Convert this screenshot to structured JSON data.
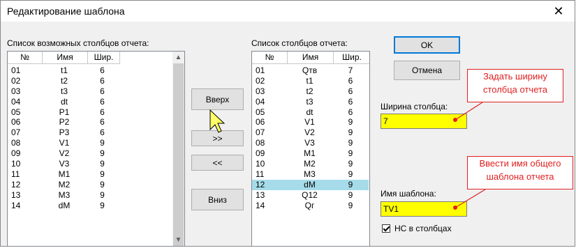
{
  "window": {
    "title": "Редактирование шаблона",
    "close_label": "✕"
  },
  "available": {
    "label": "Список возможных столбцов отчета:",
    "headers": [
      "№",
      "Имя",
      "Шир."
    ],
    "rows": [
      [
        "01",
        "t1",
        "6"
      ],
      [
        "02",
        "t2",
        "6"
      ],
      [
        "03",
        "t3",
        "6"
      ],
      [
        "04",
        "dt",
        "6"
      ],
      [
        "05",
        "P1",
        "6"
      ],
      [
        "06",
        "P2",
        "6"
      ],
      [
        "07",
        "P3",
        "6"
      ],
      [
        "08",
        "V1",
        "9"
      ],
      [
        "09",
        "V2",
        "9"
      ],
      [
        "10",
        "V3",
        "9"
      ],
      [
        "11",
        "M1",
        "9"
      ],
      [
        "12",
        "M2",
        "9"
      ],
      [
        "13",
        "M3",
        "9"
      ],
      [
        "14",
        "dM",
        "9"
      ]
    ]
  },
  "buttons": {
    "up": "Вверх",
    "add": ">>",
    "remove": "<<",
    "down": "Вниз",
    "ok": "OK",
    "cancel": "Отмена"
  },
  "report": {
    "label": "Список столбцов отчета:",
    "headers": [
      "№",
      "Имя",
      "Шир."
    ],
    "selected_index": 11,
    "rows": [
      [
        "01",
        "Qтв",
        "7"
      ],
      [
        "02",
        "t1",
        "6"
      ],
      [
        "03",
        "t2",
        "6"
      ],
      [
        "04",
        "t3",
        "6"
      ],
      [
        "05",
        "dt",
        "6"
      ],
      [
        "06",
        "V1",
        "9"
      ],
      [
        "07",
        "V2",
        "9"
      ],
      [
        "08",
        "V3",
        "9"
      ],
      [
        "09",
        "M1",
        "9"
      ],
      [
        "10",
        "M2",
        "9"
      ],
      [
        "11",
        "M3",
        "9"
      ],
      [
        "12",
        "dM",
        "9"
      ],
      [
        "13",
        "Q12",
        "9"
      ],
      [
        "14",
        "Qг",
        "9"
      ]
    ]
  },
  "width_field": {
    "label": "Ширина столбца:",
    "value": "7"
  },
  "template_field": {
    "label": "Имя шаблона:",
    "value": "TV1"
  },
  "checkbox": {
    "label": "НС в столбцах",
    "checked": true
  },
  "callouts": {
    "width": [
      "Задать ширину",
      "столбца отчета"
    ],
    "template": [
      "Ввести имя общего",
      "шаблона отчета"
    ]
  },
  "colors": {
    "field_bg": "#ffff00",
    "selected_row": "#a6dcea",
    "callout": "#e02020"
  }
}
